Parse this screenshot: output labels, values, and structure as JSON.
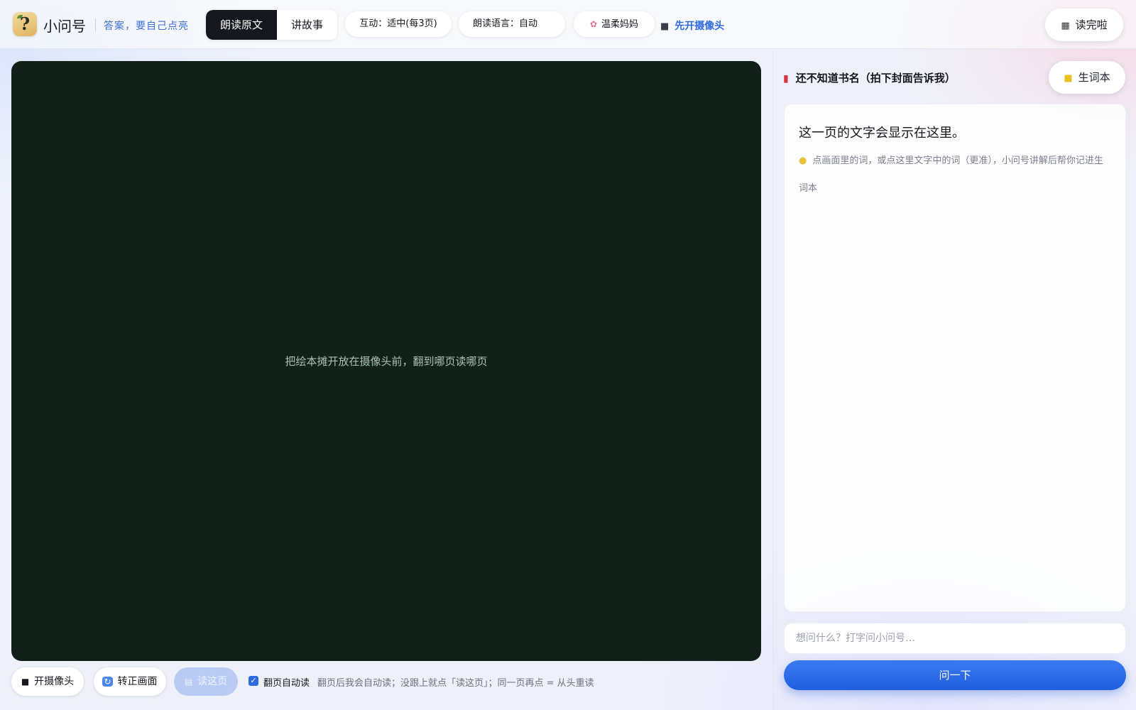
{
  "header": {
    "app_name": "小问号",
    "tagline": "答案，要自己点亮",
    "modes": [
      "朗读原文",
      "讲故事"
    ],
    "interaction": "互动：适中(每3页)",
    "read_language": "朗读语言：自动",
    "voice": "温柔妈妈",
    "voice_icon": "flower-icon",
    "camera_hint": "先开摄像头",
    "camera_hint_icon": "camera-icon",
    "done_button": "读完啦",
    "done_icon": "checkered-flag-icon"
  },
  "camera": {
    "prompt": "把绘本摊开放在摄像头前，翻到哪页读哪页"
  },
  "toolbar": {
    "open_camera": "开摄像头",
    "rotate": "转正画面",
    "read_page": "读这页",
    "auto_read_label": "翻页自动读",
    "auto_read_checked": true,
    "auto_read_hint": "翻页后我会自动读；没跟上就点「读这页」；同一页再点 = 从头重读"
  },
  "side": {
    "book_title": "还不知道书名（拍下封面告诉我）",
    "vocab_button": "生词本",
    "page_text": "这一页的文字会显示在这里。",
    "tip": "点画面里的词，或点这里文字中的词（更准），小问号讲解后帮你记进生词本",
    "ask_placeholder": "想问什么？打字问小问号…",
    "ask_button": "问一下"
  },
  "colors": {
    "accent": "#2f6be0",
    "camera_bg": "#112019",
    "active_tab": "#15181f"
  }
}
